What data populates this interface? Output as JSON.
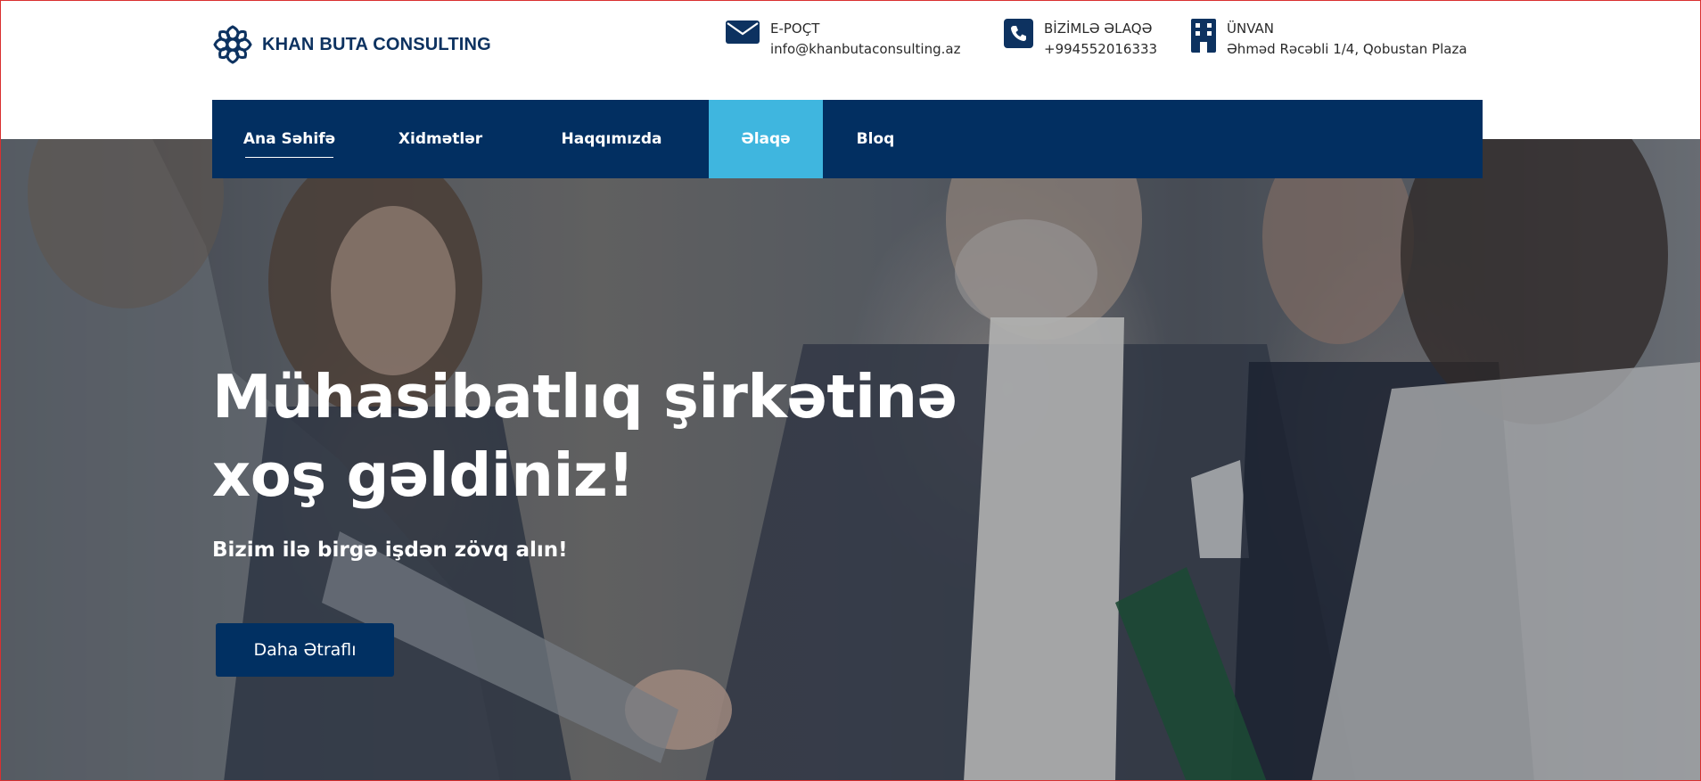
{
  "brand": {
    "name": "KHAN BUTA CONSULTING",
    "color": "#0d3260"
  },
  "contacts": {
    "email": {
      "label": "E-POÇT",
      "value": "info@khanbutaconsulting.az",
      "icon": "envelope-icon"
    },
    "phone": {
      "label": "BİZİMLƏ ƏLAQƏ",
      "value": "+994552016333",
      "icon": "phone-icon"
    },
    "address": {
      "label": "ÜNVAN",
      "value": "Əhməd Rəcəbli 1/4, Qobustan Plaza",
      "icon": "building-icon"
    }
  },
  "nav": {
    "items": [
      {
        "label": "Ana Səhifə",
        "state": "current"
      },
      {
        "label": "Xidmətlər",
        "state": "default"
      },
      {
        "label": "Haqqımızda",
        "state": "default"
      },
      {
        "label": "Əlaqə",
        "state": "highlighted"
      },
      {
        "label": "Bloq",
        "state": "default"
      }
    ],
    "background": "#022f61",
    "highlight_color": "#3fb6df"
  },
  "hero": {
    "title_line1": "Mühasibatlıq şirkətinə",
    "title_line2": "xoş gəldiniz!",
    "subtitle": "Bizim ilə birgə işdən zövq alın!",
    "button_label": "Daha Ətraflı",
    "button_color": "#013062"
  }
}
